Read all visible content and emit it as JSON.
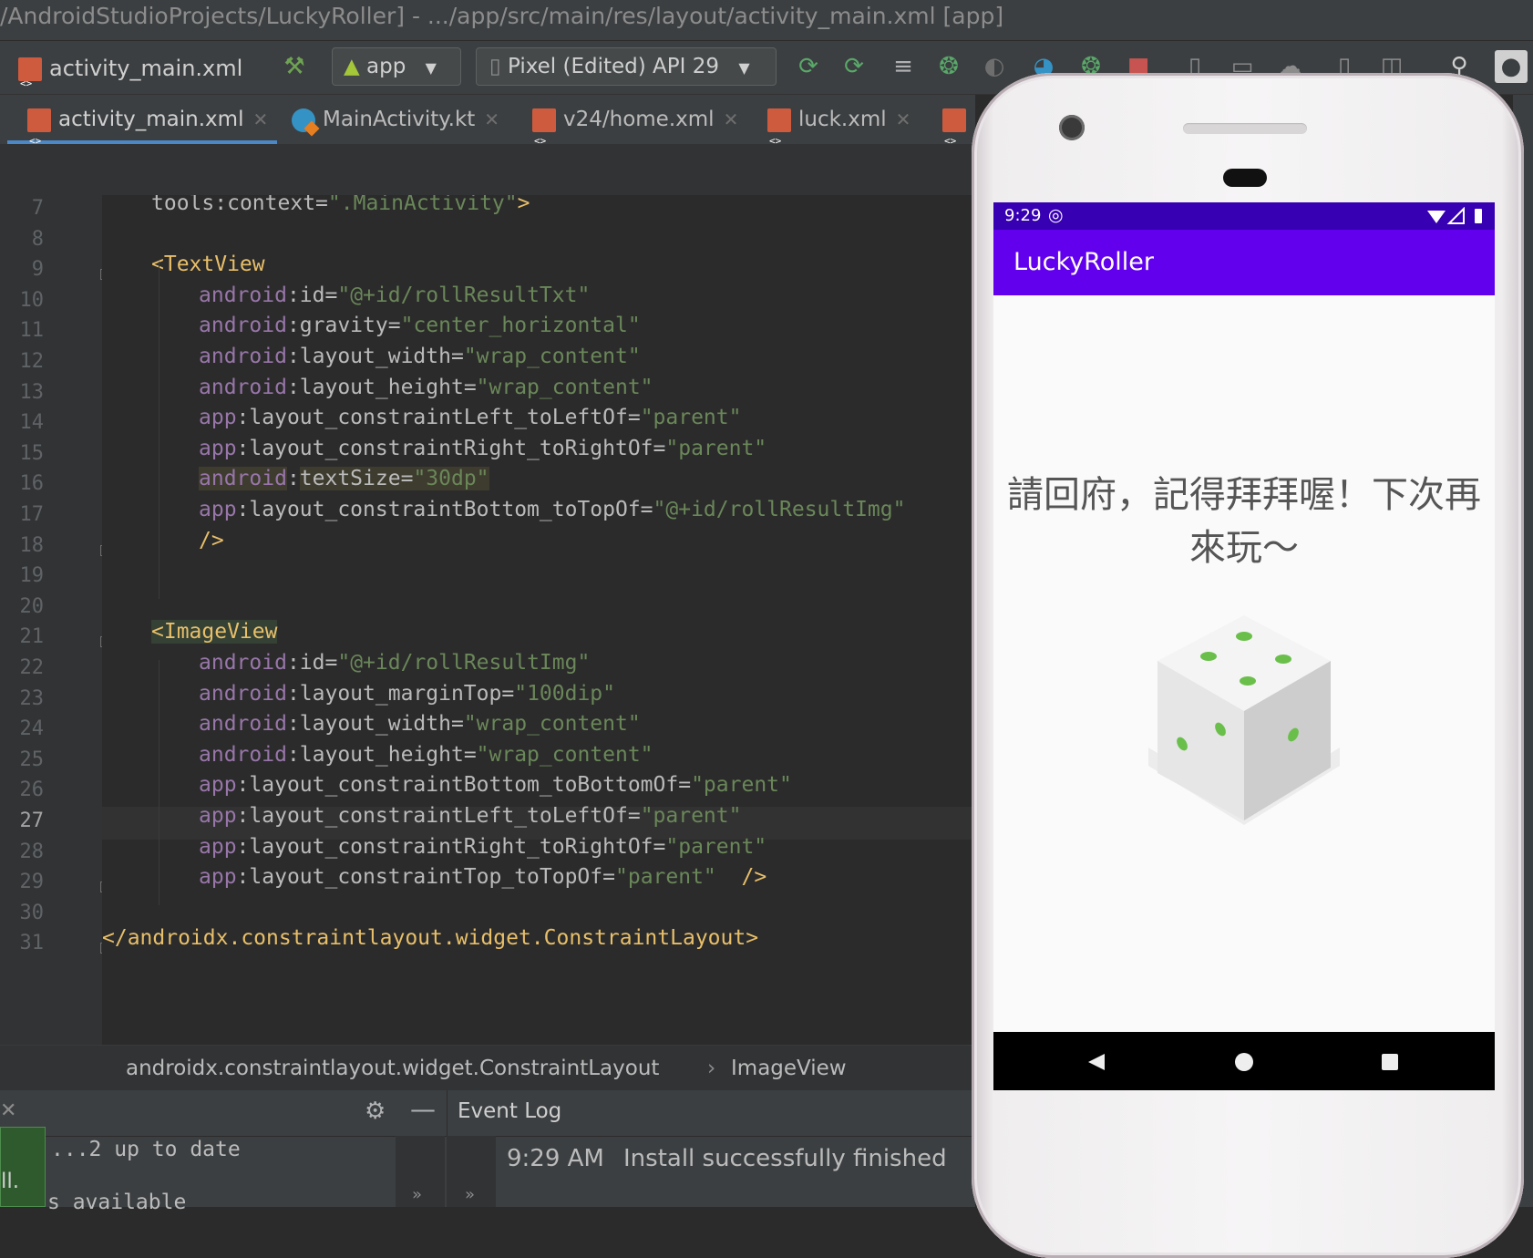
{
  "window": {
    "title": "/AndroidStudioProjects/LuckyRoller] - .../app/src/main/res/layout/activity_main.xml [app]"
  },
  "toolbar": {
    "current_file": "activity_main.xml",
    "run_config": "app",
    "device": "Pixel (Edited) API 29"
  },
  "tabs": [
    {
      "label": "activity_main.xml",
      "active": true
    },
    {
      "label": "MainActivity.kt",
      "active": false
    },
    {
      "label": "v24/home.xml",
      "active": false
    },
    {
      "label": "luck.xml",
      "active": false
    }
  ],
  "editor": {
    "current_line": 27,
    "lines": [
      {
        "n": "7",
        "parts": [
          [
            "attr",
            "tools"
          ],
          [
            "eq",
            ":"
          ],
          [
            "attr",
            "context"
          ],
          [
            "eq",
            "="
          ],
          [
            "val",
            "\".MainActivity\""
          ],
          [
            "tag",
            ">"
          ]
        ]
      },
      {
        "n": "8",
        "parts": []
      },
      {
        "n": "9",
        "parts": [
          [
            "tag",
            "<TextView"
          ]
        ]
      },
      {
        "n": "10",
        "parts": [
          [
            "ns",
            "android"
          ],
          [
            "eq",
            ":"
          ],
          [
            "attr",
            "id"
          ],
          [
            "eq",
            "="
          ],
          [
            "val",
            "\"@+id/rollResultTxt\""
          ]
        ]
      },
      {
        "n": "11",
        "parts": [
          [
            "ns",
            "android"
          ],
          [
            "eq",
            ":"
          ],
          [
            "attr",
            "gravity"
          ],
          [
            "eq",
            "="
          ],
          [
            "val",
            "\"center_horizontal\""
          ]
        ]
      },
      {
        "n": "12",
        "parts": [
          [
            "ns",
            "android"
          ],
          [
            "eq",
            ":"
          ],
          [
            "attr",
            "layout_width"
          ],
          [
            "eq",
            "="
          ],
          [
            "val",
            "\"wrap_content\""
          ]
        ]
      },
      {
        "n": "13",
        "parts": [
          [
            "ns",
            "android"
          ],
          [
            "eq",
            ":"
          ],
          [
            "attr",
            "layout_height"
          ],
          [
            "eq",
            "="
          ],
          [
            "val",
            "\"wrap_content\""
          ]
        ]
      },
      {
        "n": "14",
        "parts": [
          [
            "ns",
            "app"
          ],
          [
            "eq",
            ":"
          ],
          [
            "attr",
            "layout_constraintLeft_toLeftOf"
          ],
          [
            "eq",
            "="
          ],
          [
            "val",
            "\"parent\""
          ]
        ]
      },
      {
        "n": "15",
        "parts": [
          [
            "ns",
            "app"
          ],
          [
            "eq",
            ":"
          ],
          [
            "attr",
            "layout_constraintRight_toRightOf"
          ],
          [
            "eq",
            "="
          ],
          [
            "val",
            "\"parent\""
          ]
        ]
      },
      {
        "n": "16",
        "parts": [
          [
            "ns",
            "android"
          ],
          [
            "eq",
            ":"
          ],
          [
            "attr",
            "textSize"
          ],
          [
            "eq",
            "="
          ],
          [
            "val",
            "\"30dp\""
          ]
        ]
      },
      {
        "n": "17",
        "parts": [
          [
            "ns",
            "app"
          ],
          [
            "eq",
            ":"
          ],
          [
            "attr",
            "layout_constraintBottom_toTopOf"
          ],
          [
            "eq",
            "="
          ],
          [
            "val",
            "\"@+id/rollResultImg\""
          ]
        ]
      },
      {
        "n": "18",
        "parts": [
          [
            "tag",
            "/>"
          ]
        ]
      },
      {
        "n": "19",
        "parts": []
      },
      {
        "n": "20",
        "parts": []
      },
      {
        "n": "21",
        "parts": [
          [
            "tag",
            "<ImageView"
          ]
        ]
      },
      {
        "n": "22",
        "parts": [
          [
            "ns",
            "android"
          ],
          [
            "eq",
            ":"
          ],
          [
            "attr",
            "id"
          ],
          [
            "eq",
            "="
          ],
          [
            "val",
            "\"@+id/rollResultImg\""
          ]
        ]
      },
      {
        "n": "23",
        "parts": [
          [
            "ns",
            "android"
          ],
          [
            "eq",
            ":"
          ],
          [
            "attr",
            "layout_marginTop"
          ],
          [
            "eq",
            "="
          ],
          [
            "val",
            "\"100dip\""
          ]
        ]
      },
      {
        "n": "24",
        "parts": [
          [
            "ns",
            "android"
          ],
          [
            "eq",
            ":"
          ],
          [
            "attr",
            "layout_width"
          ],
          [
            "eq",
            "="
          ],
          [
            "val",
            "\"wrap_content\""
          ]
        ]
      },
      {
        "n": "25",
        "parts": [
          [
            "ns",
            "android"
          ],
          [
            "eq",
            ":"
          ],
          [
            "attr",
            "layout_height"
          ],
          [
            "eq",
            "="
          ],
          [
            "val",
            "\"wrap_content\""
          ]
        ]
      },
      {
        "n": "26",
        "parts": [
          [
            "ns",
            "app"
          ],
          [
            "eq",
            ":"
          ],
          [
            "attr",
            "layout_constraintBottom_toBottomOf"
          ],
          [
            "eq",
            "="
          ],
          [
            "val",
            "\"parent\""
          ]
        ]
      },
      {
        "n": "27",
        "parts": [
          [
            "ns",
            "app"
          ],
          [
            "eq",
            ":"
          ],
          [
            "attr",
            "layout_constraintLeft_toLeftOf"
          ],
          [
            "eq",
            "="
          ],
          [
            "val",
            "\"parent\""
          ]
        ]
      },
      {
        "n": "28",
        "parts": [
          [
            "ns",
            "app"
          ],
          [
            "eq",
            ":"
          ],
          [
            "attr",
            "layout_constraintRight_toRightOf"
          ],
          [
            "eq",
            "="
          ],
          [
            "val",
            "\"parent\""
          ]
        ]
      },
      {
        "n": "29",
        "parts": [
          [
            "ns",
            "app"
          ],
          [
            "eq",
            ":"
          ],
          [
            "attr",
            "layout_constraintTop_toTopOf"
          ],
          [
            "eq",
            "="
          ],
          [
            "val",
            "\"parent\""
          ],
          [
            "eq",
            "  "
          ],
          [
            "tag",
            "/>"
          ]
        ]
      },
      {
        "n": "30",
        "parts": []
      },
      {
        "n": "31",
        "parts": [
          [
            "tag",
            "</androidx.constraintlayout.widget.ConstraintLayout>"
          ]
        ]
      }
    ]
  },
  "breadcrumb": [
    "androidx.constraintlayout.widget.ConstraintLayout",
    "ImageView"
  ],
  "bottom_panel": {
    "event_log_title": "Event Log",
    "left_fragment_1": "...2 up to date",
    "left_fragment_2": "s available",
    "left_fragment_3": "ll.",
    "event_time": "9:29 AM",
    "event_message": "Install successfully finished"
  },
  "emulator": {
    "status_time": "9:29",
    "app_title": "LuckyRoller",
    "result_text": "請回府，記得拜拜喔！下次再來玩～",
    "accent": "#6200ee",
    "status_color": "#3700b3",
    "dice_pip_color": "#6abf4b"
  }
}
